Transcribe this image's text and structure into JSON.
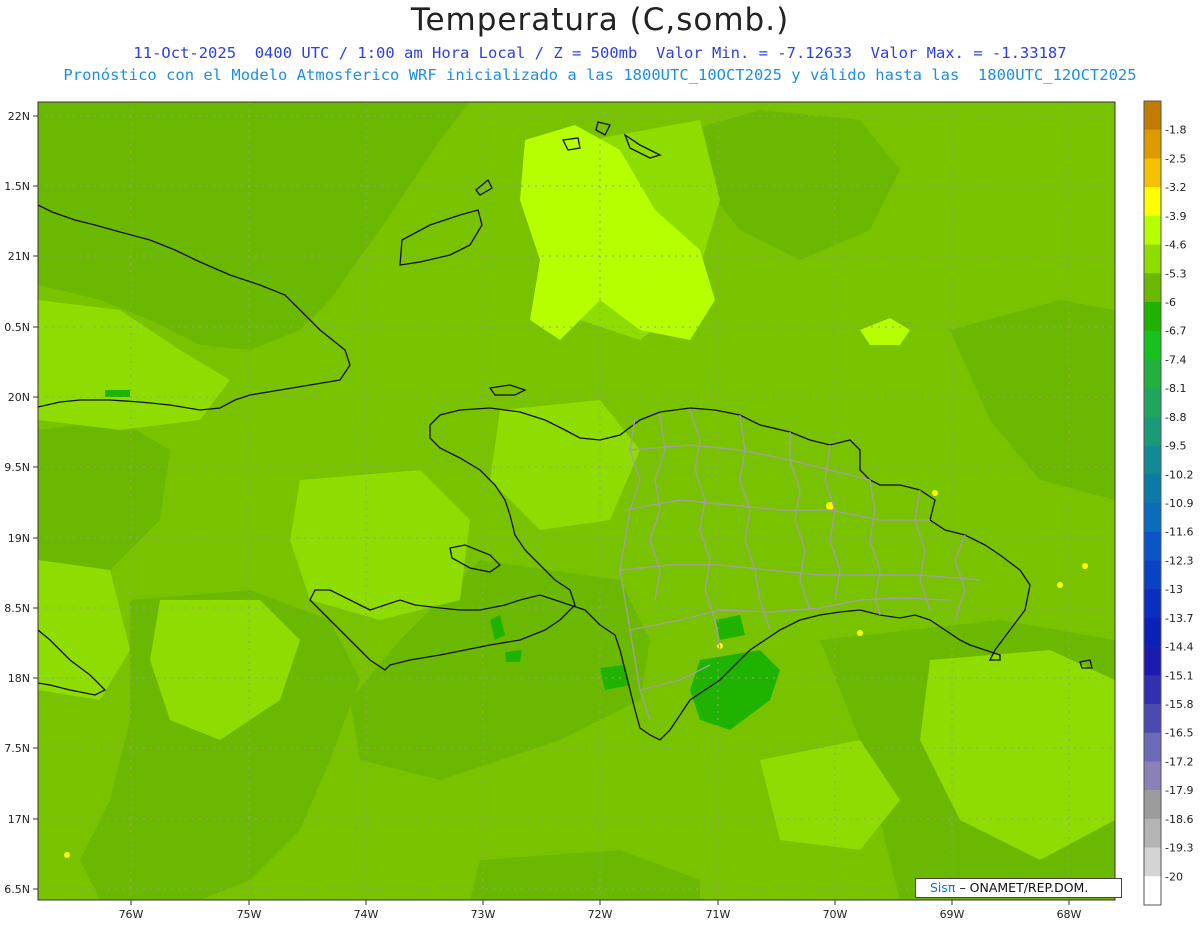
{
  "title": "Temperatura (C,somb.)",
  "subtitle_1": "11-Oct-2025  0400 UTC / 1:00 am Hora Local / Z = 500mb  Valor Min. = -7.12633  Valor Max. = -1.33187",
  "subtitle_2": "Pronóstico con el Modelo Atmosferico WRF inicializado a las 1800UTC_10OCT2025 y válido hasta las  1800UTC_12OCT2025",
  "lat_ticks": [
    "22N",
    "1.5N",
    "21N",
    "0.5N",
    "20N",
    "9.5N",
    "19N",
    "8.5N",
    "18N",
    "7.5N",
    "17N",
    "6.5N"
  ],
  "lon_ticks": [
    "76W",
    "75W",
    "74W",
    "73W",
    "72W",
    "71W",
    "70W",
    "69W",
    "68W"
  ],
  "colorbar": {
    "levels": [
      "-1.8",
      "-2.5",
      "-3.2",
      "-3.9",
      "-4.6",
      "-5.3",
      "-6",
      "-6.7",
      "-7.4",
      "-8.1",
      "-8.8",
      "-9.5",
      "-10.2",
      "-10.9",
      "-11.6",
      "-12.3",
      "-13",
      "-13.7",
      "-14.4",
      "-15.1",
      "-15.8",
      "-16.5",
      "-17.2",
      "-17.9",
      "-18.6",
      "-19.3",
      "-20"
    ],
    "colors": [
      "#c07b00",
      "#e09a00",
      "#f6c200",
      "#ffff00",
      "#b6ff00",
      "#8edc00",
      "#6bb800",
      "#1fb300",
      "#17c21a",
      "#22b03c",
      "#1fa55c",
      "#1a9a78",
      "#118a93",
      "#0c7aa8",
      "#0a6cbd",
      "#0a56c6",
      "#0a42c6",
      "#0a2ec2",
      "#0a20b8",
      "#1b1bb0",
      "#3030b0",
      "#4a4ab0",
      "#6a6ab8",
      "#8c80b8",
      "#9c9c9c",
      "#b4b4b4",
      "#d4d4d4",
      "#ffffff"
    ]
  },
  "field_colors": {
    "base": "#78c200",
    "dark": "#6bb800",
    "light": "#8edc00",
    "lighter": "#b6ff00",
    "green": "#1fb300",
    "yellow": "#ffff00"
  },
  "credit": {
    "brand": "Sisπ",
    "text": "– ONAMET/REP.DOM."
  }
}
